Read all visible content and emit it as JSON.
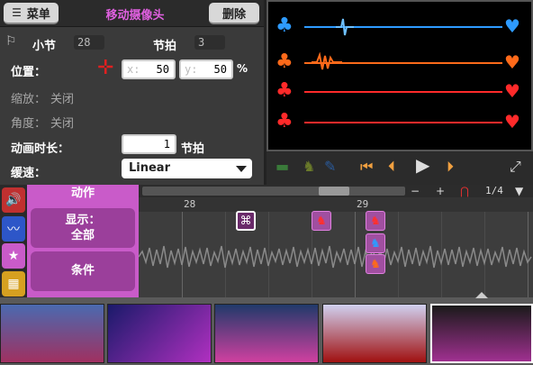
{
  "header": {
    "menu_label": "菜单",
    "title": "移动摄像头",
    "delete_label": "删除"
  },
  "fields": {
    "bar_label": "小节",
    "bar_value": "28",
    "beat_label": "节拍",
    "beat_value": "3",
    "position_label": "位置：",
    "pos_x_axis": "x:",
    "pos_x": "50",
    "pos_y_axis": "y:",
    "pos_y": "50",
    "percent": "%",
    "zoom_label": "缩放：",
    "zoom_value": "关闭",
    "angle_label": "角度：",
    "angle_value": "关闭",
    "duration_label": "动画时长：",
    "duration_value": "1",
    "duration_unit": "节拍",
    "ease_label": "缓速：",
    "ease_value": "Linear"
  },
  "actions": {
    "header": "动作",
    "show_label": "显示：",
    "show_value": "全部",
    "condition_label": "条件"
  },
  "timeline": {
    "bar_28": "28",
    "bar_29": "29",
    "page": "1/4",
    "minus": "−",
    "plus": "+"
  },
  "colors": {
    "accent": "#c95bc9",
    "row_blue": "#2e9bff",
    "row_red": "#ff2a2a",
    "row_orange": "#ff6a1a"
  }
}
